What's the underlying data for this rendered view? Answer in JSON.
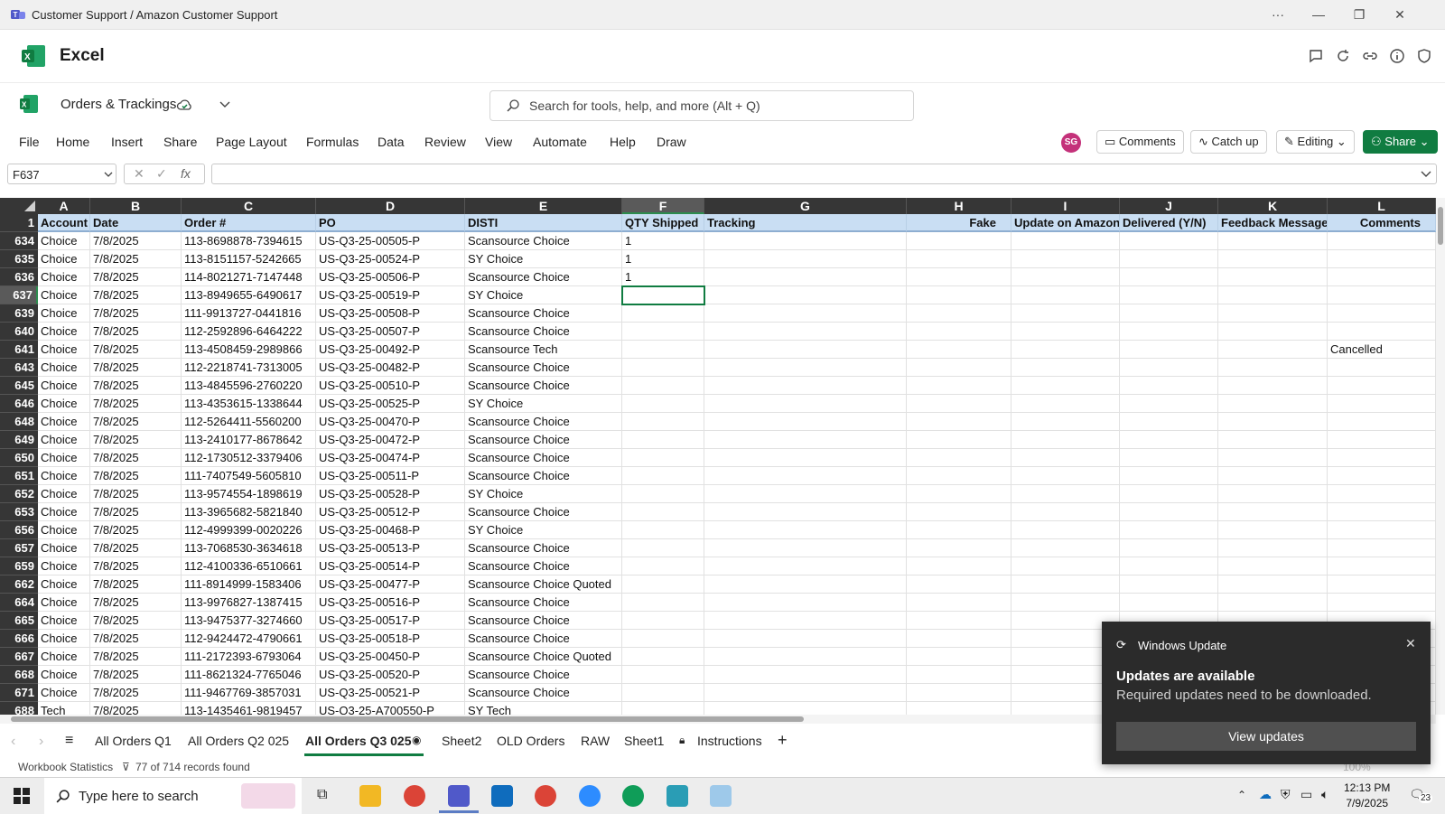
{
  "titlebar": {
    "title": "Customer Support / Amazon Customer Support"
  },
  "excel": {
    "app_name": "Excel"
  },
  "doc": {
    "name": "Orders & Trackings"
  },
  "search": {
    "placeholder": "Search for tools, help, and more (Alt + Q)"
  },
  "ribbon": {
    "menu": [
      "File",
      "Home",
      "Insert",
      "Share",
      "Page Layout",
      "Formulas",
      "Data",
      "Review",
      "View",
      "Automate",
      "Help",
      "Draw"
    ],
    "avatar": "SG",
    "comments": "Comments",
    "catchup": "Catch up",
    "editing": "Editing",
    "share": "Share"
  },
  "formula": {
    "namebox": "F637",
    "fx": "fx",
    "value": ""
  },
  "grid": {
    "columns": [
      "A",
      "B",
      "C",
      "D",
      "E",
      "F",
      "G",
      "H",
      "I",
      "J",
      "K",
      "L"
    ],
    "selected_column": "F",
    "header_row_number": "1",
    "headers": [
      "Account",
      "Date",
      "Order #",
      "PO",
      "DISTI",
      "QTY Shipped",
      "Tracking",
      "Fake",
      "Update on Amazon",
      "Delivered (Y/N)",
      "Feedback Message",
      "Comments"
    ],
    "selected_row": "637",
    "rows": [
      {
        "n": "634",
        "a": "Choice",
        "b": "7/8/2025",
        "c": "113-8698878-7394615",
        "d": "US-Q3-25-00505-P",
        "e": "Scansource Choice",
        "f": "1",
        "l": ""
      },
      {
        "n": "635",
        "a": "Choice",
        "b": "7/8/2025",
        "c": "113-8151157-5242665",
        "d": "US-Q3-25-00524-P",
        "e": "SY Choice",
        "f": "1",
        "l": ""
      },
      {
        "n": "636",
        "a": "Choice",
        "b": "7/8/2025",
        "c": "114-8021271-7147448",
        "d": "US-Q3-25-00506-P",
        "e": "Scansource Choice",
        "f": "1",
        "l": ""
      },
      {
        "n": "637",
        "a": "Choice",
        "b": "7/8/2025",
        "c": "113-8949655-6490617",
        "d": "US-Q3-25-00519-P",
        "e": "SY Choice",
        "f": "",
        "l": ""
      },
      {
        "n": "639",
        "a": "Choice",
        "b": "7/8/2025",
        "c": "111-9913727-0441816",
        "d": "US-Q3-25-00508-P",
        "e": "Scansource Choice",
        "f": "",
        "l": ""
      },
      {
        "n": "640",
        "a": "Choice",
        "b": "7/8/2025",
        "c": "112-2592896-6464222",
        "d": "US-Q3-25-00507-P",
        "e": "Scansource Choice",
        "f": "",
        "l": ""
      },
      {
        "n": "641",
        "a": "Choice",
        "b": "7/8/2025",
        "c": "113-4508459-2989866",
        "d": "US-Q3-25-00492-P",
        "e": "Scansource Tech",
        "f": "",
        "l": "Cancelled"
      },
      {
        "n": "643",
        "a": "Choice",
        "b": "7/8/2025",
        "c": "112-2218741-7313005",
        "d": "US-Q3-25-00482-P",
        "e": "Scansource Choice",
        "f": "",
        "l": ""
      },
      {
        "n": "645",
        "a": "Choice",
        "b": "7/8/2025",
        "c": "113-4845596-2760220",
        "d": "US-Q3-25-00510-P",
        "e": "Scansource Choice",
        "f": "",
        "l": ""
      },
      {
        "n": "646",
        "a": "Choice",
        "b": "7/8/2025",
        "c": "113-4353615-1338644",
        "d": "US-Q3-25-00525-P",
        "e": "SY Choice",
        "f": "",
        "l": ""
      },
      {
        "n": "648",
        "a": "Choice",
        "b": "7/8/2025",
        "c": "112-5264411-5560200",
        "d": "US-Q3-25-00470-P",
        "e": "Scansource Choice",
        "f": "",
        "l": ""
      },
      {
        "n": "649",
        "a": "Choice",
        "b": "7/8/2025",
        "c": "113-2410177-8678642",
        "d": "US-Q3-25-00472-P",
        "e": "Scansource Choice",
        "f": "",
        "l": ""
      },
      {
        "n": "650",
        "a": "Choice",
        "b": "7/8/2025",
        "c": "112-1730512-3379406",
        "d": "US-Q3-25-00474-P",
        "e": "Scansource Choice",
        "f": "",
        "l": ""
      },
      {
        "n": "651",
        "a": "Choice",
        "b": "7/8/2025",
        "c": "111-7407549-5605810",
        "d": "US-Q3-25-00511-P",
        "e": "Scansource Choice",
        "f": "",
        "l": ""
      },
      {
        "n": "652",
        "a": "Choice",
        "b": "7/8/2025",
        "c": "113-9574554-1898619",
        "d": "US-Q3-25-00528-P",
        "e": "SY Choice",
        "f": "",
        "l": ""
      },
      {
        "n": "653",
        "a": "Choice",
        "b": "7/8/2025",
        "c": "113-3965682-5821840",
        "d": "US-Q3-25-00512-P",
        "e": "Scansource Choice",
        "f": "",
        "l": ""
      },
      {
        "n": "656",
        "a": "Choice",
        "b": "7/8/2025",
        "c": "112-4999399-0020226",
        "d": "US-Q3-25-00468-P",
        "e": "SY Choice",
        "f": "",
        "l": ""
      },
      {
        "n": "657",
        "a": "Choice",
        "b": "7/8/2025",
        "c": "113-7068530-3634618",
        "d": "US-Q3-25-00513-P",
        "e": "Scansource Choice",
        "f": "",
        "l": ""
      },
      {
        "n": "659",
        "a": "Choice",
        "b": "7/8/2025",
        "c": "112-4100336-6510661",
        "d": "US-Q3-25-00514-P",
        "e": "Scansource Choice",
        "f": "",
        "l": ""
      },
      {
        "n": "662",
        "a": "Choice",
        "b": "7/8/2025",
        "c": "111-8914999-1583406",
        "d": "US-Q3-25-00477-P",
        "e": "Scansource Choice Quoted",
        "f": "",
        "l": ""
      },
      {
        "n": "664",
        "a": "Choice",
        "b": "7/8/2025",
        "c": "113-9976827-1387415",
        "d": "US-Q3-25-00516-P",
        "e": "Scansource Choice",
        "f": "",
        "l": ""
      },
      {
        "n": "665",
        "a": "Choice",
        "b": "7/8/2025",
        "c": "113-9475377-3274660",
        "d": "US-Q3-25-00517-P",
        "e": "Scansource Choice",
        "f": "",
        "l": ""
      },
      {
        "n": "666",
        "a": "Choice",
        "b": "7/8/2025",
        "c": "112-9424472-4790661",
        "d": "US-Q3-25-00518-P",
        "e": "Scansource Choice",
        "f": "",
        "l": ""
      },
      {
        "n": "667",
        "a": "Choice",
        "b": "7/8/2025",
        "c": "111-2172393-6793064",
        "d": "US-Q3-25-00450-P",
        "e": "Scansource Choice Quoted",
        "f": "",
        "l": ""
      },
      {
        "n": "668",
        "a": "Choice",
        "b": "7/8/2025",
        "c": "111-8621324-7765046",
        "d": "US-Q3-25-00520-P",
        "e": "Scansource Choice",
        "f": "",
        "l": ""
      },
      {
        "n": "671",
        "a": "Choice",
        "b": "7/8/2025",
        "c": "111-9467769-3857031",
        "d": "US-Q3-25-00521-P",
        "e": "Scansource Choice",
        "f": "",
        "l": ""
      },
      {
        "n": "688",
        "a": "Tech",
        "b": "7/8/2025",
        "c": "113-1435461-9819457",
        "d": "US-Q3-25-A700550-P",
        "e": "SY Tech",
        "f": "",
        "l": ""
      }
    ]
  },
  "sheets": {
    "tabs": [
      "All Orders Q1",
      "All Orders Q2 025",
      "All Orders Q3 025",
      "Sheet2",
      "OLD Orders",
      "RAW",
      "Sheet1",
      "Instructions"
    ],
    "active": "All Orders Q3 025"
  },
  "status": {
    "stats": "Workbook Statistics",
    "filter": "77 of 714 records found",
    "zoom": "100%"
  },
  "taskbar": {
    "search_placeholder": "Type here to search",
    "time": "12:13 PM",
    "date": "7/9/2025",
    "notif_count": "23"
  },
  "toast": {
    "source": "Windows Update",
    "heading": "Updates are available",
    "body": "Required updates need to be downloaded.",
    "button": "View updates"
  },
  "colors": {
    "excel_green": "#107c41",
    "header_fill": "#c9def3",
    "grid_header_dark": "#363636"
  }
}
